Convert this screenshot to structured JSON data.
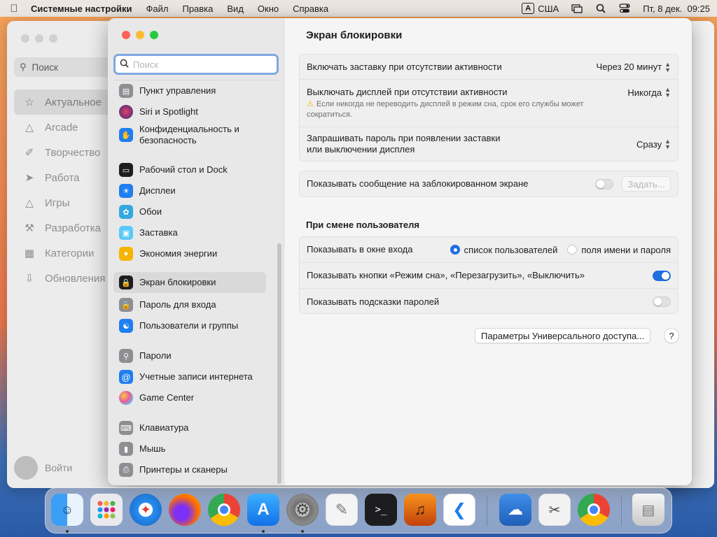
{
  "menubar": {
    "app_name": "Системные настройки",
    "items": [
      "Файл",
      "Правка",
      "Вид",
      "Окно",
      "Справка"
    ],
    "input_source_letter": "A",
    "input_source": "США",
    "datetime": "Пт, 8 дек.  09:25"
  },
  "back_window": {
    "search_label": "Поиск",
    "nav": [
      {
        "label": "Актуальное",
        "icon": "star-icon",
        "active": true
      },
      {
        "label": "Arcade",
        "icon": "arcade-icon"
      },
      {
        "label": "Творчество",
        "icon": "brush-icon"
      },
      {
        "label": "Работа",
        "icon": "paperplane-icon"
      },
      {
        "label": "Игры",
        "icon": "rocket-icon"
      },
      {
        "label": "Разработка",
        "icon": "hammer-icon"
      },
      {
        "label": "Категории",
        "icon": "grid-icon"
      },
      {
        "label": "Обновления",
        "icon": "download-icon"
      }
    ],
    "login_label": "Войти"
  },
  "sidebar": {
    "search_placeholder": "Поиск",
    "items": [
      {
        "label": "Пункт управления",
        "icon": "control-center-icon",
        "color": "#8e8e93"
      },
      {
        "label": "Siri и Spotlight",
        "icon": "siri-icon",
        "color": "#3b2b7a"
      },
      {
        "label": "Конфиденциальность и безопасность",
        "icon": "hand-icon",
        "color": "#1f7ef0"
      },
      {
        "label": "Рабочий стол и Dock",
        "icon": "dock-icon",
        "color": "#1d1d1f"
      },
      {
        "label": "Дисплеи",
        "icon": "sun-icon",
        "color": "#1f7ef0"
      },
      {
        "label": "Обои",
        "icon": "flower-icon",
        "color": "#34a8e0"
      },
      {
        "label": "Заставка",
        "icon": "screensaver-icon",
        "color": "#5ac8fa"
      },
      {
        "label": "Экономия энергии",
        "icon": "bulb-icon",
        "color": "#f5b400"
      },
      {
        "label": "Экран блокировки",
        "icon": "lock-screen-icon",
        "color": "#1d1d1f",
        "active": true
      },
      {
        "label": "Пароль для входа",
        "icon": "lock-icon",
        "color": "#8e8e93"
      },
      {
        "label": "Пользователи и группы",
        "icon": "users-icon",
        "color": "#1f7ef0"
      },
      {
        "label": "Пароли",
        "icon": "key-icon",
        "color": "#8e8e93"
      },
      {
        "label": "Учетные записи интернета",
        "icon": "at-icon",
        "color": "#1f7ef0"
      },
      {
        "label": "Game Center",
        "icon": "game-center-icon",
        "color": "#f0a0c0"
      },
      {
        "label": "Клавиатура",
        "icon": "keyboard-icon",
        "color": "#8e8e93"
      },
      {
        "label": "Мышь",
        "icon": "mouse-icon",
        "color": "#8e8e93"
      },
      {
        "label": "Принтеры и сканеры",
        "icon": "printer-icon",
        "color": "#8e8e93"
      }
    ]
  },
  "content": {
    "title": "Экран блокировки",
    "group1": {
      "screensaver_label": "Включать заставку при отсутствии активности",
      "screensaver_value": "Через 20 минут",
      "display_off_label": "Выключать дисплей при отсутствии активности",
      "display_off_value": "Никогда",
      "warning": "Если никогда не переводить дисплей в режим сна, срок его службы может сократиться.",
      "password_label": "Запрашивать пароль при появлении заставки или выключении дисплея",
      "password_value": "Сразу"
    },
    "message_label": "Показывать сообщение на заблокированном экране",
    "message_enabled": false,
    "set_button": "Задать...",
    "switch_user_header": "При смене пользователя",
    "login_window_label": "Показывать в окне входа",
    "radio_users_list": "список пользователей",
    "radio_name_password": "поля имени и пароля",
    "selected_option": "список пользователей",
    "power_buttons_label": "Показывать кнопки «Режим сна», «Перезагрузить», «Выключить»",
    "power_buttons_enabled": true,
    "hints_label": "Показывать подсказки паролей",
    "hints_enabled": false,
    "accessibility_button": "Параметры Универсального доступа...",
    "help_button": "?"
  },
  "dock": {
    "apps": [
      {
        "name": "Finder",
        "icon": "finder-icon",
        "running": true
      },
      {
        "name": "Launchpad",
        "icon": "launchpad-icon"
      },
      {
        "name": "Safari",
        "icon": "safari-icon"
      },
      {
        "name": "Firefox",
        "icon": "firefox-icon"
      },
      {
        "name": "Chrome",
        "icon": "chrome-icon"
      },
      {
        "name": "App Store",
        "icon": "app-store-icon",
        "running": true
      },
      {
        "name": "System Settings",
        "icon": "system-settings-icon",
        "running": true
      },
      {
        "name": "TextEdit",
        "icon": "textedit-icon"
      },
      {
        "name": "Terminal",
        "icon": "terminal-icon"
      },
      {
        "name": "GarageBand",
        "icon": "garageband-icon"
      },
      {
        "name": "VS Code",
        "icon": "vscode-icon"
      },
      {
        "name": "Weather",
        "icon": "weather-icon"
      },
      {
        "name": "Preview",
        "icon": "preview-icon"
      },
      {
        "name": "Chrome",
        "icon": "chrome-icon-2"
      },
      {
        "name": "Trash",
        "icon": "trash-icon"
      }
    ]
  }
}
